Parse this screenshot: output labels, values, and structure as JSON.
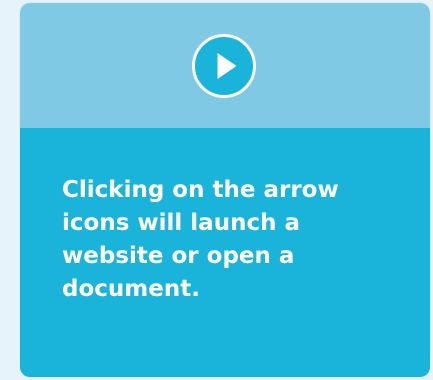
{
  "card": {
    "message": "Clicking on the arrow icons will launch a website or open a document.",
    "play_icon": "play-arrow-icon"
  },
  "colors": {
    "page_background": "#e6f3fb",
    "card_top": "#7fc9e4",
    "card_bottom": "#1ab3da",
    "icon_fill": "#1ab3da",
    "icon_stroke": "#ffffff",
    "text": "#ffffff"
  }
}
